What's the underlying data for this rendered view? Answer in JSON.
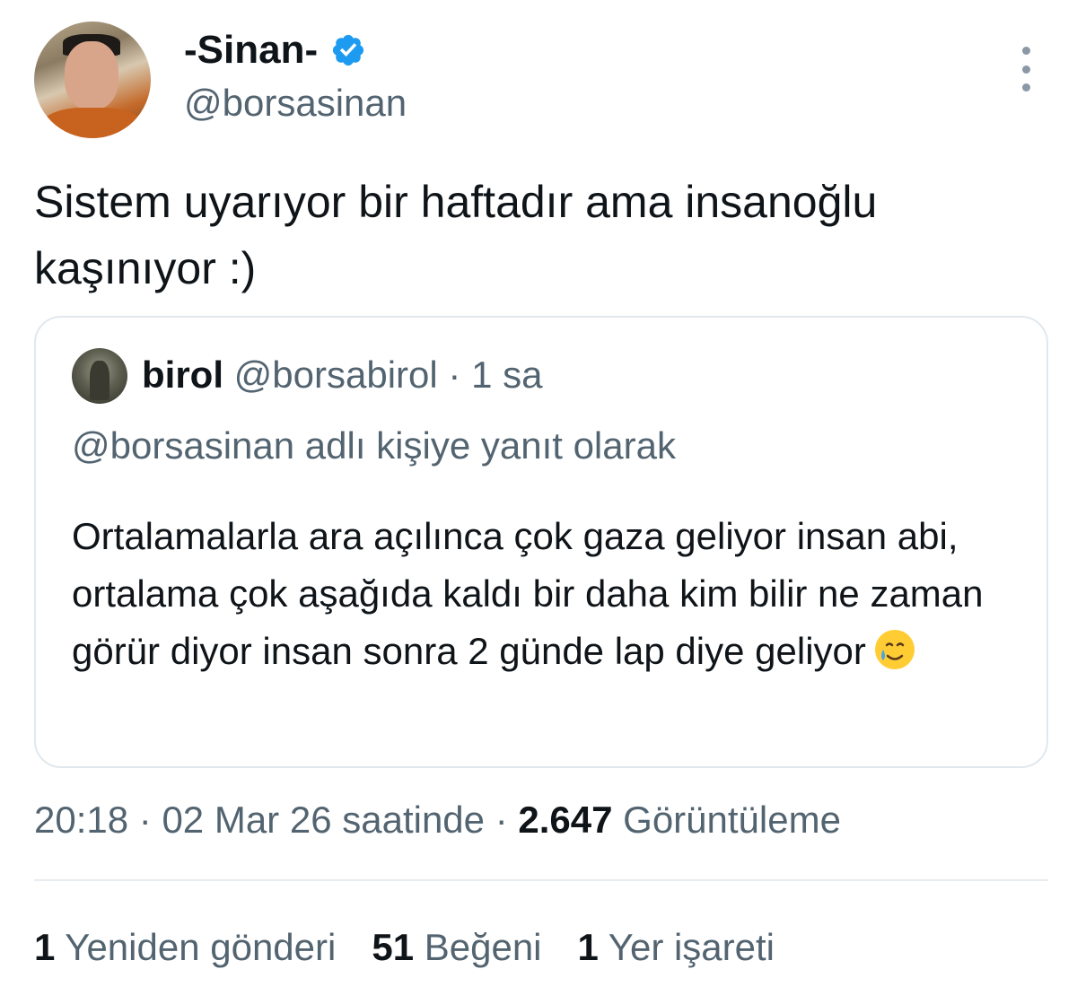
{
  "author": {
    "display_name": "-Sinan-",
    "handle": "@borsasinan",
    "verified_icon": "verified-badge-icon",
    "verified_color": "#1d9bf0"
  },
  "tweet": {
    "text": "Sistem uyarıyor bir haftadır ama insanoğlu kaşınıyor :)"
  },
  "quote": {
    "name": "birol",
    "handle": "@borsabirol",
    "separator": "·",
    "time": "1 sa",
    "reply_context": "@borsasinan adlı kişiye yanıt olarak",
    "text": "Ortalamalarla ara açılınca çok gaza geliyor insan abi, ortalama çok aşağıda kaldı bir daha kim bilir ne zaman görür diyor insan sonra 2 günde lap diye geliyor",
    "emoji": "smiling-face-with-tear-icon"
  },
  "meta": {
    "time": "20:18",
    "separator": "·",
    "date": "02 Mar 26 saatinde",
    "views_count": "2.647",
    "views_label": "Görüntüleme"
  },
  "stats": {
    "reposts_count": "1",
    "reposts_label": "Yeniden gönderi",
    "likes_count": "51",
    "likes_label": "Beğeni",
    "bookmarks_count": "1",
    "bookmarks_label": "Yer işareti"
  }
}
